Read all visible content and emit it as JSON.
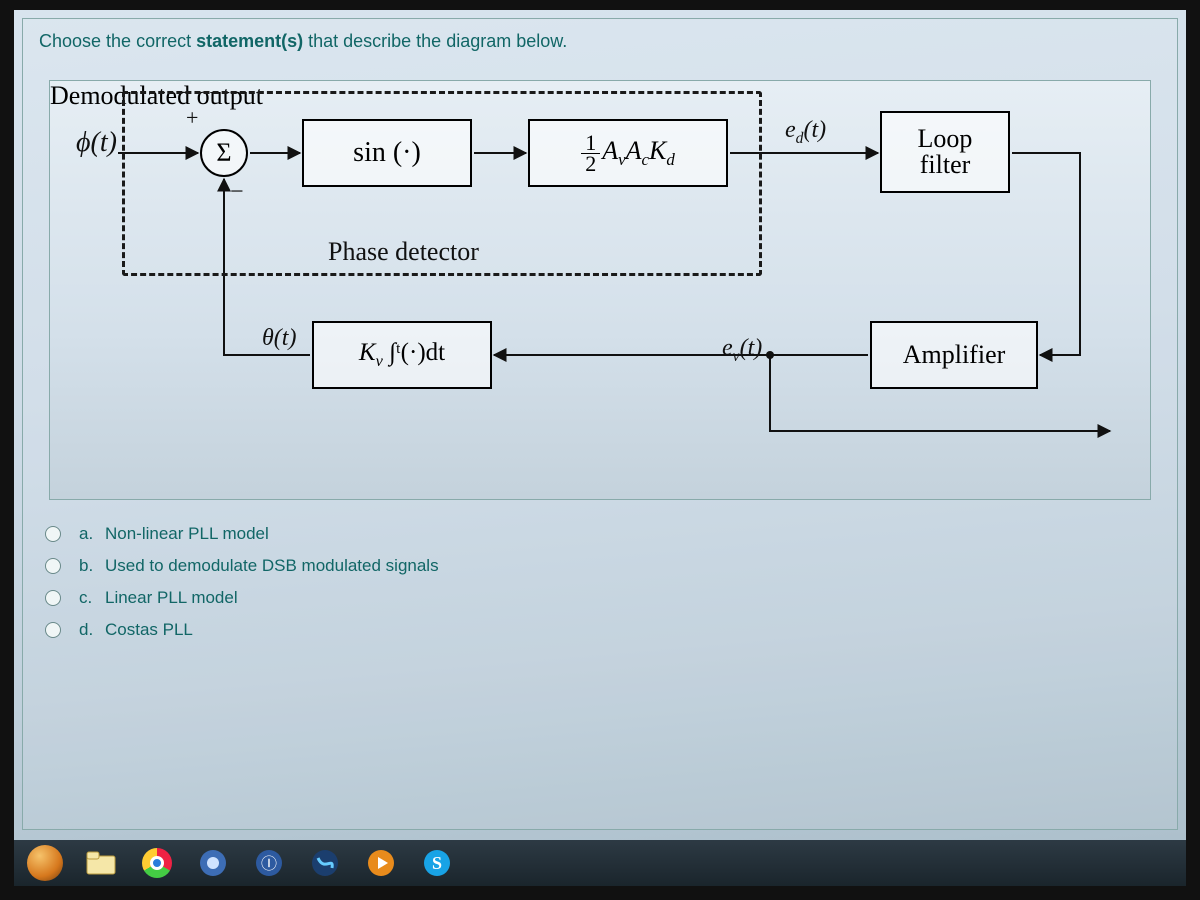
{
  "question": {
    "prefix": "Choose the correct ",
    "bold": "statement(s)",
    "suffix": " that describe the diagram below."
  },
  "diagram": {
    "input_label": "ϕ(t)",
    "summer_symbol": "Σ",
    "plus": "+",
    "minus": "−",
    "sin_label": "sin (·)",
    "gain_label_prefix": "A",
    "gain_label_v": "v",
    "gain_label_c": "c",
    "gain_label_K": "K",
    "gain_label_d": "d",
    "gain_half_num": "1",
    "gain_half_den": "2",
    "ed_label": "e_d(t)",
    "loop_line1": "Loop",
    "loop_line2": "filter",
    "theta_label": "θ(t)",
    "vco_K": "K",
    "vco_v": "v",
    "vco_int": "∫ᵗ(·)dt",
    "ev_label": "e_v(t)",
    "amp_label": "Amplifier",
    "pd_label": "Phase detector",
    "demod_label": "Demodulated output"
  },
  "options": [
    {
      "letter": "a.",
      "text": "Non-linear PLL model"
    },
    {
      "letter": "b.",
      "text": "Used to demodulate DSB modulated signals"
    },
    {
      "letter": "c.",
      "text": "Linear PLL model"
    },
    {
      "letter": "d.",
      "text": "Costas PLL"
    }
  ],
  "taskbar": {
    "icons": [
      "firefox",
      "explorer",
      "chrome",
      "app4",
      "app5",
      "app6",
      "media",
      "skype"
    ]
  }
}
